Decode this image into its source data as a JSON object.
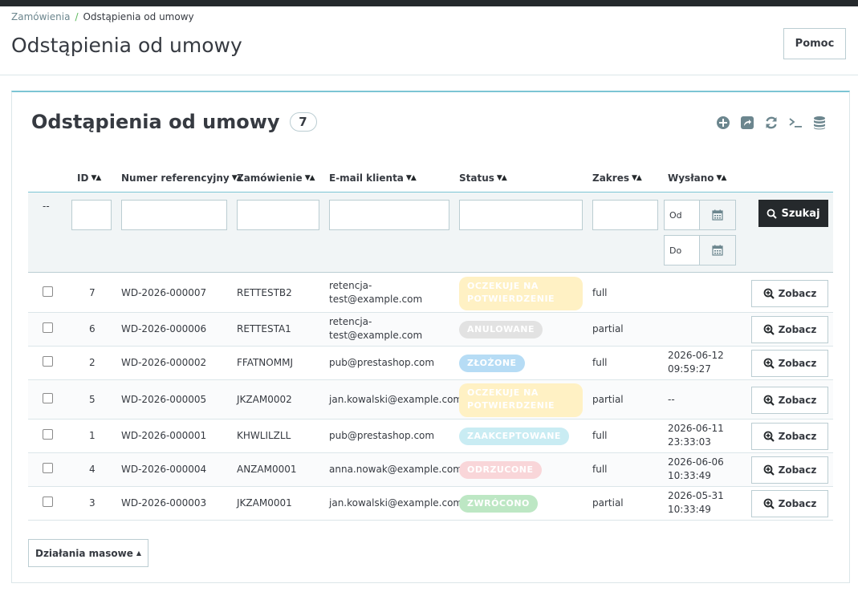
{
  "breadcrumb": {
    "parent": "Zamówienia",
    "separator": "/",
    "current": "Odstąpienia od umowy"
  },
  "page_title": "Odstąpienia od umowy",
  "help_label": "Pomoc",
  "panel": {
    "title": "Odstąpienia od umowy",
    "count": "7",
    "tools": [
      "add-icon",
      "export-icon",
      "refresh-icon",
      "sql-icon",
      "database-icon"
    ]
  },
  "columns": {
    "id": "ID",
    "reference": "Numer referencyjny",
    "order": "Zamówienie",
    "email": "E-mail klienta",
    "status": "Status",
    "scope": "Zakres",
    "sent": "Wysłano"
  },
  "filters": {
    "placeholder_dashes": "--",
    "date_from": "Od",
    "date_to": "Do",
    "search_label": "Szukaj"
  },
  "view_label": "Zobacz",
  "bulk_label": "Działania masowe",
  "rows": [
    {
      "id": "7",
      "reference": "WD-2026-000007",
      "order": "RETTESTB2",
      "email_l1": "retencja-",
      "email_l2": "test@example.com",
      "status_l1": "OCZEKUJE NA",
      "status_l2": "POTWIERDZENIE",
      "scope": "full",
      "sent_l1": "",
      "sent_l2": ""
    },
    {
      "id": "6",
      "reference": "WD-2026-000006",
      "order": "RETTESTA1",
      "email_l1": "retencja-",
      "email_l2": "test@example.com",
      "status_l1": "ANULOWANE",
      "status_l2": "",
      "scope": "partial",
      "sent_l1": "",
      "sent_l2": ""
    },
    {
      "id": "2",
      "reference": "WD-2026-000002",
      "order": "FFATNOMMJ",
      "email_l1": "pub@prestashop.com",
      "email_l2": "",
      "status_l1": "ZŁOŻONE",
      "status_l2": "",
      "scope": "full",
      "sent_l1": "2026-06-12",
      "sent_l2": "09:59:27"
    },
    {
      "id": "5",
      "reference": "WD-2026-000005",
      "order": "JKZAM0002",
      "email_l1": "jan.kowalski@example.com",
      "email_l2": "",
      "status_l1": "OCZEKUJE NA",
      "status_l2": "POTWIERDZENIE",
      "scope": "partial",
      "sent_l1": "--",
      "sent_l2": ""
    },
    {
      "id": "1",
      "reference": "WD-2026-000001",
      "order": "KHWLILZLL",
      "email_l1": "pub@prestashop.com",
      "email_l2": "",
      "status_l1": "ZAAKCEPTOWANE",
      "status_l2": "",
      "scope": "full",
      "sent_l1": "2026-06-11",
      "sent_l2": "23:33:03"
    },
    {
      "id": "4",
      "reference": "WD-2026-000004",
      "order": "ANZAM0001",
      "email_l1": "anna.nowak@example.com",
      "email_l2": "",
      "status_l1": "ODRZUCONE",
      "status_l2": "",
      "scope": "full",
      "sent_l1": "2026-06-06",
      "sent_l2": "10:33:49"
    },
    {
      "id": "3",
      "reference": "WD-2026-000003",
      "order": "JKZAM0001",
      "email_l1": "jan.kowalski@example.com",
      "email_l2": "",
      "status_l1": "ZWRÓCONO",
      "status_l2": "",
      "scope": "partial",
      "sent_l1": "2026-05-31",
      "sent_l2": "10:33:49"
    }
  ],
  "status_colors": {
    "pending": "#fff1c4",
    "cancelled": "#e2e2e2",
    "submitted": "#b6dcf5",
    "accepted": "#c9ecf3",
    "rejected": "#f9d6d9",
    "returned": "#bde7c4"
  }
}
